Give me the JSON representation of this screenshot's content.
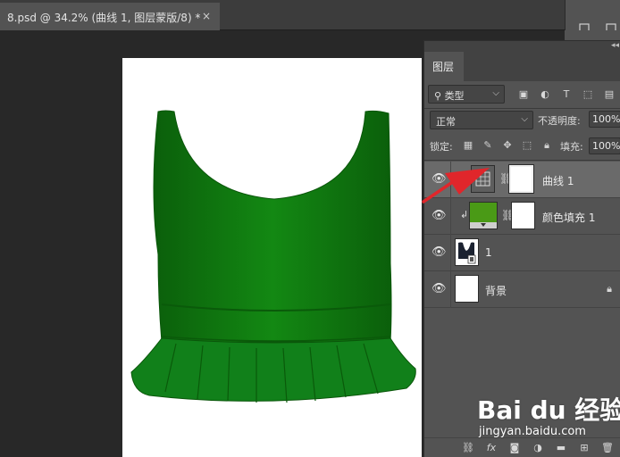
{
  "document_tab": {
    "title": "8.psd @ 34.2% (曲线 1, 图层蒙版/8) *",
    "close_glyph": "×"
  },
  "layers_panel": {
    "tab_label": "图层",
    "filter_kind": "类型",
    "blend_mode": "正常",
    "opacity_label": "不透明度:",
    "opacity_value": "100%",
    "lock_label": "锁定:",
    "fill_label": "填充:",
    "fill_value": "100%",
    "layers": [
      {
        "name": "曲线 1",
        "type": "curves-adjustment",
        "selected": true,
        "clipped": true,
        "has_mask": true
      },
      {
        "name": "颜色填充 1",
        "type": "color-fill",
        "selected": false,
        "clipped": true,
        "has_mask": true,
        "fill_color": "#4a9a16"
      },
      {
        "name": "1",
        "type": "pixel",
        "selected": false,
        "clipped": false,
        "has_mask": false
      },
      {
        "name": "背景",
        "type": "background",
        "selected": false,
        "clipped": false,
        "has_mask": false,
        "locked": true
      }
    ],
    "footer_icons": [
      "link-icon",
      "fx-icon",
      "add-mask-icon",
      "adjustment-icon",
      "group-folder-icon",
      "new-layer-icon",
      "trash-icon"
    ]
  },
  "canvas": {
    "garment_color": "#0f7a0f",
    "background": "#ffffff"
  },
  "annotation": {
    "arrow_color": "#e0262b"
  },
  "watermark": {
    "brand": "Bai du 经验",
    "url": "jingyan.baidu.com"
  },
  "colors": {
    "workspace": "#282828",
    "panel": "#535353",
    "selected_row": "#6a6a6a"
  }
}
